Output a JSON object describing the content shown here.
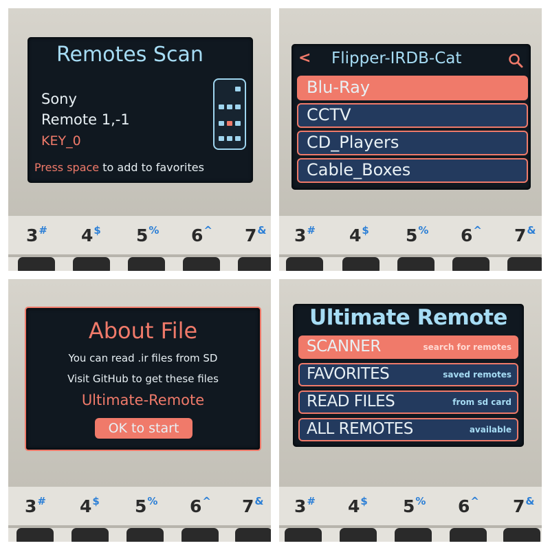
{
  "keyboard": {
    "keys": [
      {
        "digit": "3",
        "symbol": "#"
      },
      {
        "digit": "4",
        "symbol": "$"
      },
      {
        "digit": "5",
        "symbol": "%"
      },
      {
        "digit": "6",
        "symbol": "^"
      },
      {
        "digit": "7",
        "symbol": "&"
      }
    ]
  },
  "scan_screen": {
    "title": "Remotes Scan",
    "brand": "Sony",
    "remote": "Remote 1,-1",
    "key": "KEY_0",
    "hint_highlight": "Press space",
    "hint_rest": "to add to favorites"
  },
  "list_screen": {
    "back_symbol": "<",
    "title": "Flipper-IRDB-Cat",
    "items": [
      "Blu-Ray",
      "CCTV",
      "CD_Players",
      "Cable_Boxes"
    ],
    "selected_index": 0
  },
  "about_screen": {
    "title": "About File",
    "line1": "You can read .ir files from SD",
    "line2": "Visit GitHub to get these files",
    "app_name": "Ultimate-Remote",
    "ok_button": "OK to start"
  },
  "menu_screen": {
    "title": "Ultimate Remote",
    "items": [
      {
        "label": "SCANNER",
        "sub": "search for remotes"
      },
      {
        "label": "FAVORITES",
        "sub": "saved remotes"
      },
      {
        "label": "READ FILES",
        "sub": "from sd card"
      },
      {
        "label": "ALL REMOTES",
        "sub": "available"
      }
    ],
    "selected_index": 0
  },
  "colors": {
    "accent_salmon": "#f07a6a",
    "accent_cyan": "#a6dcf4",
    "row_navy": "#233a5e",
    "screen_bg": "#101820"
  }
}
